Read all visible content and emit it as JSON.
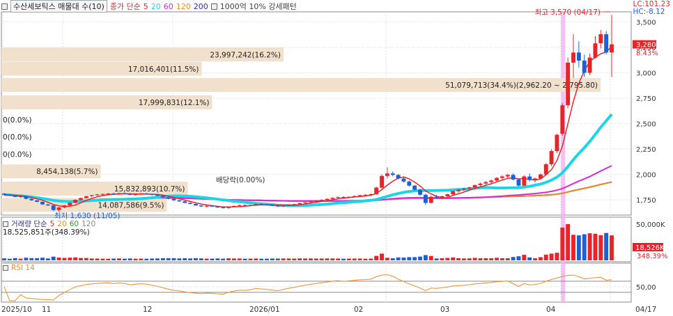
{
  "header": {
    "stock_name": "수산세보틱스 매물대 수(10)",
    "ma_title": "종가 단순",
    "ma_periods": [
      "5",
      "20",
      "60",
      "120",
      "200"
    ],
    "pattern_label": "1000억 10% 강세패턴"
  },
  "tags": {
    "lc": "LC:101.23",
    "hc": "HC:-8.12"
  },
  "volume_header": {
    "title": "거래량 단순",
    "periods": [
      "5",
      "20",
      "60",
      "120"
    ],
    "summary": "18,525,851주(348.39%)"
  },
  "rsi_header": {
    "title": "RSI 14"
  },
  "price_axis": {
    "ticks": [
      "3,500",
      "3,250",
      "3,000",
      "2,750",
      "2,500",
      "2,250",
      "2,000",
      "1,750"
    ]
  },
  "volume_axis": {
    "ticks": [
      "50,000K"
    ]
  },
  "rsi_axis": {
    "ticks": [
      "50,00"
    ]
  },
  "price_badge": {
    "value": "3,280",
    "change": "8.43%"
  },
  "volume_badge": {
    "value": "18,526K",
    "change": "348.39%"
  },
  "annotations": {
    "high": "최고 3,570 (04/17)",
    "low": "최저 1,630 (11/05)",
    "dividend": "배당락(0.00%)"
  },
  "date_axis": [
    "2025/10",
    "11",
    "12",
    "2026/01",
    "02",
    "03",
    "04",
    "04/17"
  ],
  "colors": {
    "up": "#e8242a",
    "down": "#1f5fd6",
    "ma5": "#e8242a",
    "ma20": "#19d6e6",
    "ma60": "#d928d9",
    "ma120": "#f08a24",
    "ma200": "#2b2ba8",
    "profile": "#f0e0cc",
    "highlight": "#f3b0f0"
  },
  "chart_data": {
    "type": "candlestick",
    "price_range": [
      1600,
      3600
    ],
    "volume_profile": [
      {
        "label": "23,997,242(16.2%)",
        "share": 16.2
      },
      {
        "label": "17,016,401(11.5%)",
        "share": 11.5
      },
      {
        "label": "51,079,713(34.4%)(2,962.20 ~ 2,795.80)",
        "share": 34.4
      },
      {
        "label": "17,999,831(12.1%)",
        "share": 12.1
      },
      {
        "label": "0(0.0%)",
        "share": 0.0
      },
      {
        "label": "0(0.0%)",
        "share": 0.0
      },
      {
        "label": "0(0.0%)",
        "share": 0.0
      },
      {
        "label": "8,454,138(5.7%)",
        "share": 5.7
      },
      {
        "label": "15,832,893(10.7%)",
        "share": 10.7
      },
      {
        "label": "14,087,586(9.5%)",
        "share": 9.5
      }
    ],
    "volume_profile_levels": [
      3180,
      3040,
      2880,
      2710,
      2540,
      2370,
      2200,
      2030,
      1860,
      1700
    ],
    "candles": [
      [
        1812,
        1815,
        1795,
        1800
      ],
      [
        1800,
        1808,
        1790,
        1797
      ],
      [
        1797,
        1802,
        1775,
        1780
      ],
      [
        1780,
        1790,
        1770,
        1785
      ],
      [
        1785,
        1788,
        1755,
        1760
      ],
      [
        1760,
        1768,
        1740,
        1745
      ],
      [
        1745,
        1750,
        1725,
        1730
      ],
      [
        1730,
        1735,
        1700,
        1705
      ],
      [
        1705,
        1712,
        1690,
        1695
      ],
      [
        1695,
        1700,
        1640,
        1650
      ],
      [
        1650,
        1680,
        1630,
        1675
      ],
      [
        1675,
        1700,
        1668,
        1695
      ],
      [
        1695,
        1725,
        1690,
        1720
      ],
      [
        1720,
        1755,
        1715,
        1750
      ],
      [
        1750,
        1772,
        1742,
        1768
      ],
      [
        1768,
        1790,
        1760,
        1786
      ],
      [
        1786,
        1800,
        1775,
        1795
      ],
      [
        1795,
        1808,
        1788,
        1803
      ],
      [
        1803,
        1812,
        1795,
        1808
      ],
      [
        1808,
        1818,
        1800,
        1812
      ],
      [
        1812,
        1820,
        1800,
        1805
      ],
      [
        1805,
        1820,
        1800,
        1815
      ],
      [
        1815,
        1822,
        1805,
        1810
      ],
      [
        1810,
        1818,
        1795,
        1800
      ],
      [
        1800,
        1810,
        1792,
        1805
      ],
      [
        1805,
        1815,
        1800,
        1812
      ],
      [
        1812,
        1820,
        1805,
        1808
      ],
      [
        1808,
        1812,
        1795,
        1800
      ],
      [
        1800,
        1805,
        1785,
        1790
      ],
      [
        1790,
        1795,
        1770,
        1775
      ],
      [
        1775,
        1780,
        1755,
        1760
      ],
      [
        1760,
        1765,
        1740,
        1745
      ],
      [
        1745,
        1752,
        1730,
        1735
      ],
      [
        1735,
        1740,
        1715,
        1720
      ],
      [
        1720,
        1728,
        1705,
        1710
      ],
      [
        1710,
        1715,
        1690,
        1695
      ],
      [
        1695,
        1700,
        1680,
        1685
      ],
      [
        1685,
        1695,
        1675,
        1690
      ],
      [
        1690,
        1698,
        1680,
        1684
      ],
      [
        1684,
        1690,
        1670,
        1675
      ],
      [
        1675,
        1682,
        1665,
        1670
      ],
      [
        1670,
        1685,
        1665,
        1682
      ],
      [
        1682,
        1695,
        1678,
        1690
      ],
      [
        1690,
        1702,
        1685,
        1698
      ],
      [
        1698,
        1706,
        1690,
        1694
      ],
      [
        1694,
        1702,
        1688,
        1700
      ],
      [
        1700,
        1712,
        1695,
        1708
      ],
      [
        1708,
        1716,
        1700,
        1704
      ],
      [
        1704,
        1712,
        1696,
        1700
      ],
      [
        1700,
        1704,
        1688,
        1692
      ],
      [
        1692,
        1698,
        1680,
        1685
      ],
      [
        1685,
        1696,
        1680,
        1694
      ],
      [
        1694,
        1705,
        1690,
        1702
      ],
      [
        1702,
        1712,
        1698,
        1708
      ],
      [
        1708,
        1722,
        1704,
        1718
      ],
      [
        1718,
        1730,
        1712,
        1726
      ],
      [
        1726,
        1740,
        1720,
        1735
      ],
      [
        1735,
        1748,
        1730,
        1742
      ],
      [
        1742,
        1755,
        1736,
        1750
      ],
      [
        1750,
        1764,
        1745,
        1760
      ],
      [
        1760,
        1775,
        1754,
        1770
      ],
      [
        1770,
        1782,
        1762,
        1778
      ],
      [
        1778,
        1786,
        1768,
        1774
      ],
      [
        1774,
        1784,
        1766,
        1780
      ],
      [
        1780,
        1792,
        1774,
        1788
      ],
      [
        1788,
        1800,
        1780,
        1796
      ],
      [
        1796,
        1806,
        1788,
        1800
      ],
      [
        1800,
        1812,
        1792,
        1806
      ],
      [
        1806,
        1880,
        1800,
        1870
      ],
      [
        1870,
        2000,
        1860,
        1985
      ],
      [
        1985,
        2070,
        1960,
        2010
      ],
      [
        2010,
        2030,
        1980,
        1995
      ],
      [
        1995,
        2005,
        1950,
        1960
      ],
      [
        1960,
        1975,
        1920,
        1930
      ],
      [
        1930,
        1940,
        1880,
        1890
      ],
      [
        1890,
        1895,
        1840,
        1850
      ],
      [
        1850,
        1860,
        1790,
        1800
      ],
      [
        1800,
        1810,
        1700,
        1720
      ],
      [
        1720,
        1790,
        1715,
        1780
      ],
      [
        1780,
        1800,
        1760,
        1770
      ],
      [
        1770,
        1790,
        1760,
        1785
      ],
      [
        1785,
        1810,
        1775,
        1805
      ],
      [
        1805,
        1840,
        1800,
        1835
      ],
      [
        1835,
        1860,
        1820,
        1850
      ],
      [
        1850,
        1870,
        1835,
        1860
      ],
      [
        1860,
        1880,
        1845,
        1872
      ],
      [
        1872,
        1900,
        1860,
        1895
      ],
      [
        1895,
        1920,
        1880,
        1910
      ],
      [
        1910,
        1935,
        1895,
        1925
      ],
      [
        1925,
        1950,
        1910,
        1940
      ],
      [
        1940,
        1975,
        1930,
        1965
      ],
      [
        1965,
        1990,
        1950,
        1980
      ],
      [
        1980,
        2005,
        1965,
        1995
      ],
      [
        1995,
        2010,
        1940,
        1950
      ],
      [
        1950,
        1960,
        1880,
        1890
      ],
      [
        1890,
        1990,
        1885,
        1980
      ],
      [
        1980,
        2010,
        1930,
        1945
      ],
      [
        1945,
        1970,
        1920,
        1960
      ],
      [
        1960,
        2010,
        1950,
        2000
      ],
      [
        2000,
        2110,
        1990,
        2100
      ],
      [
        2100,
        2250,
        2080,
        2230
      ],
      [
        2230,
        2400,
        2210,
        2390
      ],
      [
        2400,
        2700,
        2380,
        2680
      ],
      [
        2680,
        3150,
        2650,
        3100
      ],
      [
        3100,
        3380,
        2950,
        3200
      ],
      [
        3200,
        3310,
        3050,
        3120
      ],
      [
        3120,
        3180,
        2960,
        3000
      ],
      [
        3000,
        3190,
        2980,
        3150
      ],
      [
        3150,
        3360,
        3140,
        3290
      ],
      [
        3290,
        3420,
        3240,
        3380
      ],
      [
        3380,
        3410,
        3180,
        3200
      ],
      [
        3200,
        3570,
        2960,
        3280
      ]
    ]
  }
}
